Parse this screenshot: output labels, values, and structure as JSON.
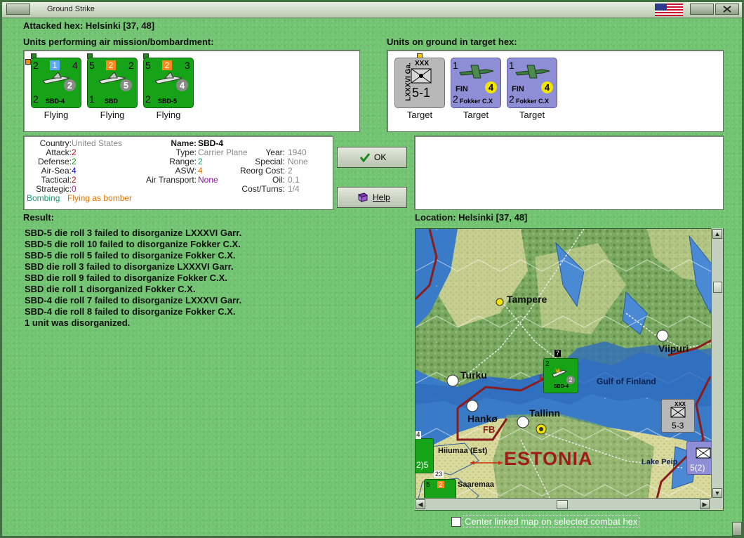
{
  "window": {
    "title": "Ground Strike"
  },
  "attacked_hex": "Attacked hex: Helsinki  [37, 48]",
  "air_units_label": "Units performing air mission/bombardment:",
  "ground_units_label": "Units on ground in target hex:",
  "air_units": [
    {
      "name": "SBD-4",
      "top_left": "2",
      "top_right": "4",
      "bottom_left": "2",
      "badge": "1",
      "badge_color": "#5aa8ff",
      "circle": "2",
      "status": "Flying"
    },
    {
      "name": "SBD",
      "top_left": "5",
      "top_right": "2",
      "bottom_left": "1",
      "badge": "2",
      "badge_color": "#ff8a1a",
      "circle": "5",
      "status": "Flying"
    },
    {
      "name": "SBD-5",
      "top_left": "5",
      "top_right": "3",
      "bottom_left": "2",
      "badge": "2",
      "badge_color": "#ff8a1a",
      "circle": "4",
      "status": "Flying"
    }
  ],
  "ground_units": [
    {
      "name": "LXXXVI Ga.",
      "size": "XXX",
      "strength": "5-1",
      "status": "Target"
    },
    {
      "name": "Fokker C.X",
      "nation": "FIN",
      "top_left": "1",
      "bottom_left": "2",
      "circle": "4",
      "status": "Target"
    },
    {
      "name": "Fokker C.X",
      "nation": "FIN",
      "top_left": "1",
      "bottom_left": "2",
      "circle": "4",
      "status": "Target"
    }
  ],
  "details": {
    "country_label": "Country:",
    "country": "United States",
    "attack_label": "Attack:",
    "attack": "2",
    "defense_label": "Defense:",
    "defense": "2",
    "airsea_label": "Air-Sea:",
    "airsea": "4",
    "tactical_label": "Tactical:",
    "tactical": "2",
    "strategic_label": "Strategic:",
    "strategic": "0",
    "mission": "Bombing",
    "mission_note": "Flying as bomber",
    "name_label": "Name:",
    "name": "SBD-4",
    "type_label": "Type:",
    "type": "Carrier Plane",
    "range_label": "Range:",
    "range": "2",
    "asw_label": "ASW:",
    "asw": "4",
    "air_transport_label": "Air Transport:",
    "air_transport": "None",
    "year_label": "Year:",
    "year": "1940",
    "special_label": "Special:",
    "special": "None",
    "reorg_label": "Reorg Cost:",
    "reorg": "2",
    "oil_label": "Oil:",
    "oil": "0.1",
    "cost_label": "Cost/Turns:",
    "cost": "1/4"
  },
  "buttons": {
    "ok": "OK",
    "help": "Help"
  },
  "result_label": "Result:",
  "results": [
    "SBD-5 die roll 3 failed to disorganize LXXXVI Garr.",
    "SBD-5 die roll 10 failed to disorganize Fokker C.X.",
    "SBD-5 die roll 5 failed to disorganize Fokker C.X.",
    "SBD die roll 3 failed to disorganize LXXXVI Garr.",
    "SBD die roll 9 failed to disorganize Fokker C.X.",
    "SBD die roll 1 disorganized Fokker C.X.",
    "SBD-4 die roll 7 failed to disorganize LXXXVI Garr.",
    "SBD-4 die roll 8 failed to disorganize Fokker C.X.",
    "1 unit was disorganized."
  ],
  "location_label": "Location:  Helsinki  [37, 48]",
  "map": {
    "places": [
      "Tampere",
      "Viipuri",
      "Turku",
      "Gulf of Finland",
      "Hankø",
      "FB",
      "Tallinn",
      "Hiiumaa (Est)",
      "ESTONIA",
      "Lake Peip",
      "Saaremaa"
    ],
    "unit_garrison_strength": "5-3",
    "unit_garrison_size": "XXX",
    "unit_blue_strength": "5(2)",
    "map_unit_stack_count": "7",
    "map_unit_stack2": "23",
    "map_unit_name": "SBD-4",
    "map_unit_digit": "2",
    "map_unit_circle": "2",
    "helsinki_mark": "H",
    "left_edge_digit": "4",
    "left_edge_strength": "2)5",
    "bottom_unit_badge": "2",
    "bottom_unit_circle": "5",
    "bottom_unit_digits": "5"
  },
  "center_map_label": "Center linked map on selected combat hex"
}
